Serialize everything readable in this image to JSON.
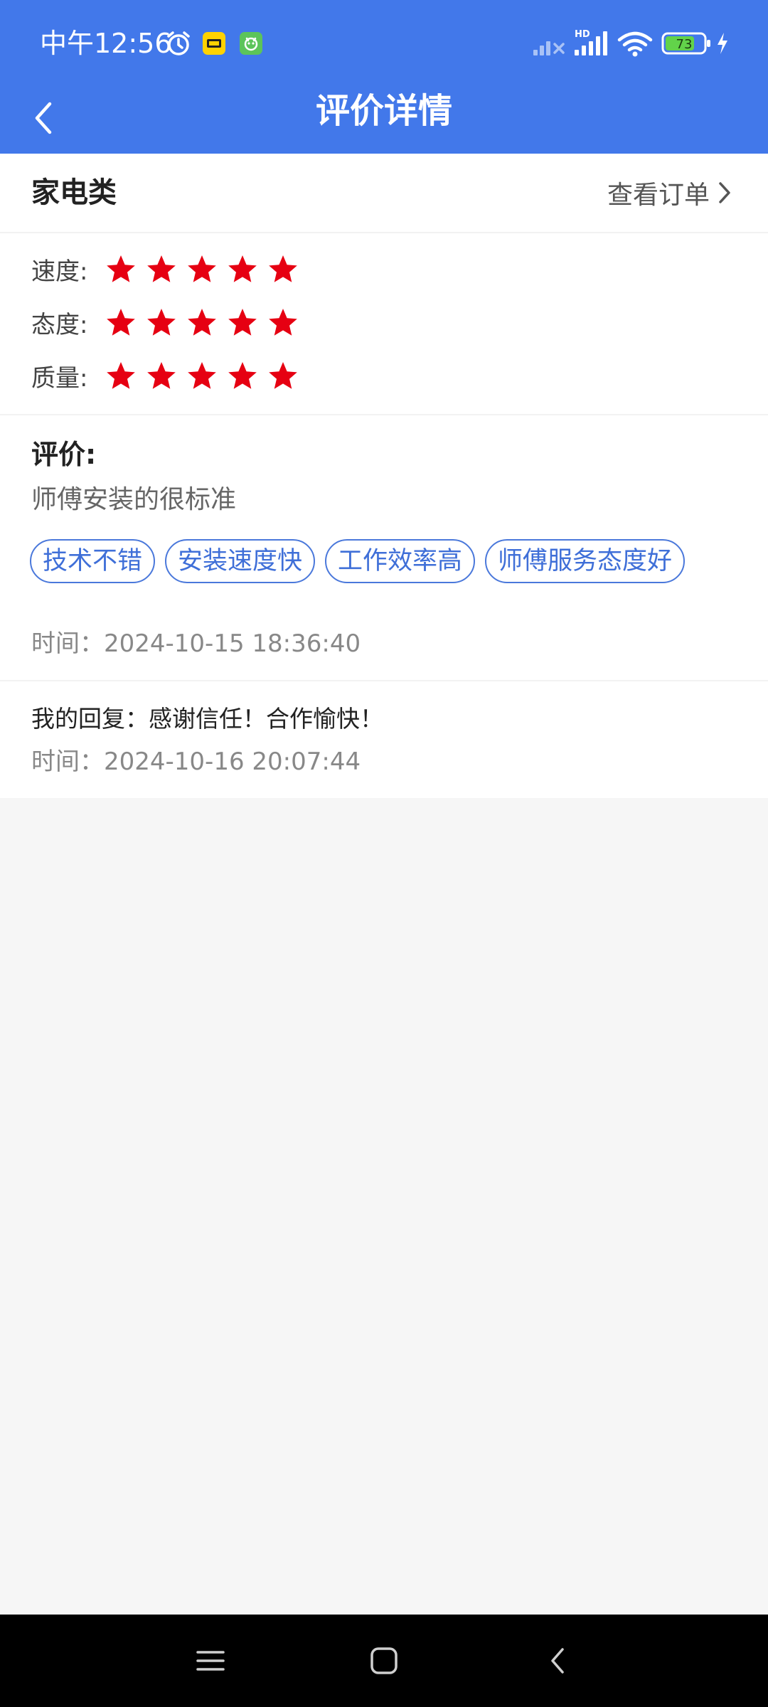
{
  "status_bar": {
    "time": "中午12:56",
    "battery": "73",
    "network_label": "HD",
    "icons": [
      "alarm-icon",
      "app-notification-icon",
      "app-notification-icon",
      "signal-weak-icon",
      "signal-strong-icon",
      "wifi-icon",
      "battery-icon",
      "charging-icon"
    ]
  },
  "header": {
    "title": "评价详情",
    "back_icon": "chevron-left-icon"
  },
  "category": {
    "name": "家电类",
    "view_order_label": "查看订单"
  },
  "ratings": [
    {
      "label": "速度:",
      "stars": 5,
      "max": 5
    },
    {
      "label": "态度:",
      "stars": 5,
      "max": 5
    },
    {
      "label": "质量:",
      "stars": 5,
      "max": 5
    }
  ],
  "review": {
    "heading": "评价:",
    "text": "师傅安装的很标准",
    "tags": [
      "技术不错",
      "安装速度快",
      "工作效率高",
      "师傅服务态度好"
    ],
    "time": "时间：2024-10-15 18:36:40"
  },
  "reply": {
    "text": "我的回复：感谢信任！合作愉快！",
    "time": "时间：2024-10-16 20:07:44"
  },
  "colors": {
    "header_bg": "#4278ea",
    "star": "#e60012",
    "tag_border": "#4a78db",
    "page_bg": "#f6f6f6"
  },
  "nav": {
    "icons": [
      "menu-icon",
      "home-icon",
      "back-icon"
    ]
  }
}
